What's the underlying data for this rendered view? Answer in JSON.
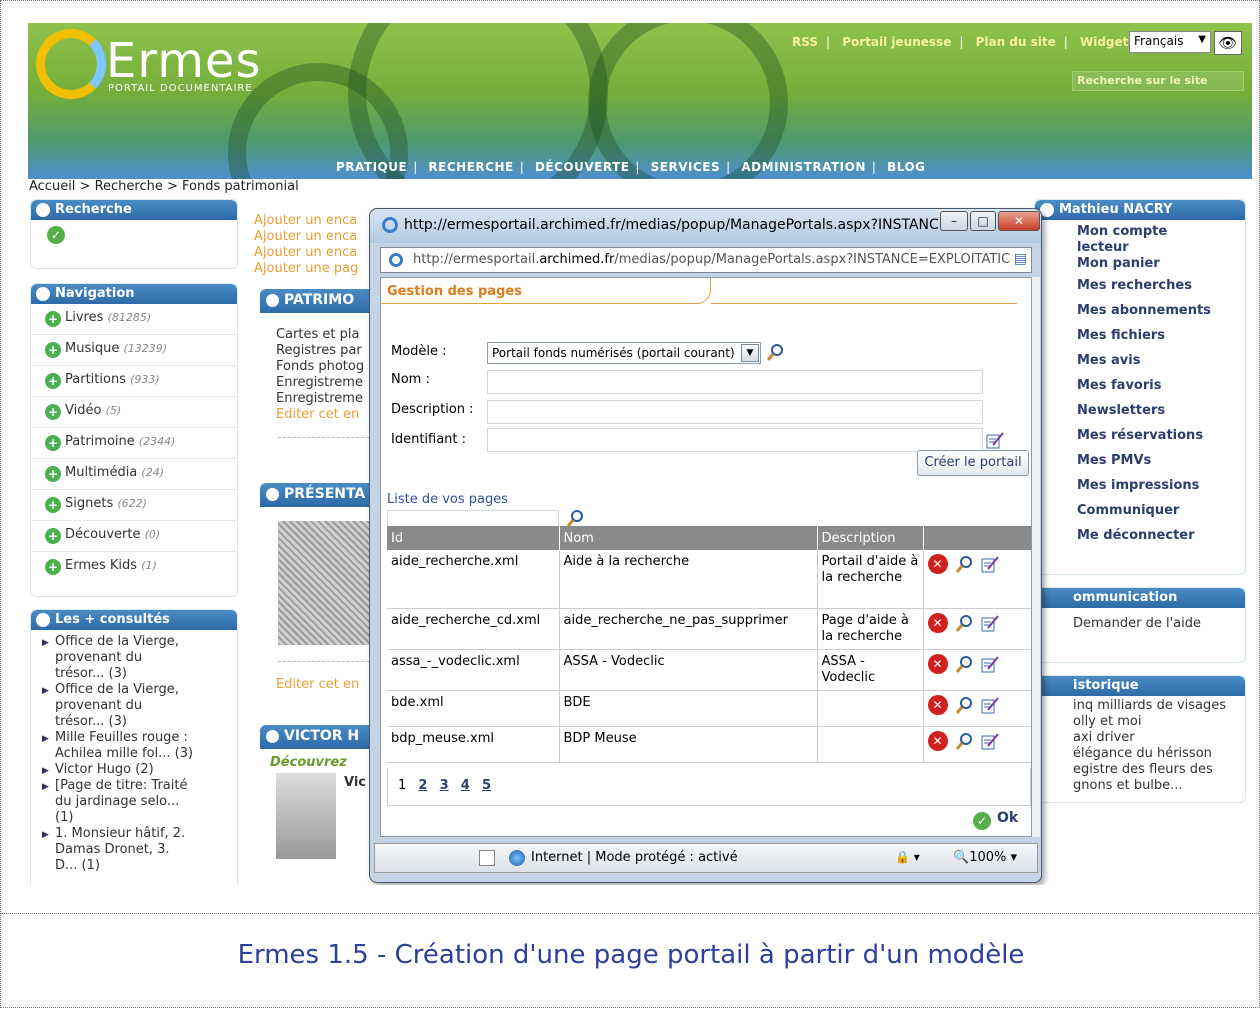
{
  "banner": {
    "logo_text": "Ermes",
    "logo_sub": "PORTAIL DOCUMENTAIRE",
    "top_links": [
      "RSS",
      "Portail jeunesse",
      "Plan du site",
      "Widgets"
    ],
    "language": "Français",
    "site_search_placeholder": "Recherche sur le site",
    "menu": [
      "PRATIQUE",
      "RECHERCHE",
      "DÉCOUVERTE",
      "SERVICES",
      "ADMINISTRATION",
      "BLOG"
    ]
  },
  "breadcrumb": "Accueil > Recherche > Fonds patrimonial",
  "left": {
    "recherche_title": "Recherche",
    "navigation_title": "Navigation",
    "nav_items": [
      {
        "label": "Livres",
        "count": "(81285)"
      },
      {
        "label": "Musique",
        "count": "(13239)"
      },
      {
        "label": "Partitions",
        "count": "(933)"
      },
      {
        "label": "Vidéo",
        "count": "(5)"
      },
      {
        "label": "Patrimoine",
        "count": "(2344)"
      },
      {
        "label": "Multimédia",
        "count": "(24)"
      },
      {
        "label": "Signets",
        "count": "(622)"
      },
      {
        "label": "Découverte",
        "count": "(0)"
      },
      {
        "label": "Ermes Kids",
        "count": "(1)"
      }
    ],
    "consultes_title": "Les + consultés",
    "consultes": [
      "Office de la Vierge, provenant du trésor... (3)",
      "Office de la Vierge, provenant du trésor... (3)",
      "Mille Feuilles rouge : Achilea mille fol... (3)",
      "Victor Hugo (2)",
      "[Page de titre: Traité du jardinage selo... (1)",
      "1. Monsieur hâtif, 2. Damas Dronet, 3. D... (1)"
    ]
  },
  "middle": {
    "add_links": [
      "Ajouter un enca",
      "Ajouter un enca",
      "Ajouter un enca",
      "Ajouter une pag"
    ],
    "patrimoine_title": "PATRIMO",
    "patrimoine_lines": [
      "Cartes et pla",
      "Registres par",
      "Fonds photog",
      "Enregistreme",
      "Enregistreme",
      "Editer cet en"
    ],
    "presentation_title": "PRÉSENTA",
    "edit_link": "Editer cet en",
    "victor_title": "VICTOR H",
    "decouvrez": "Découvrez",
    "vic": "Vic"
  },
  "right": {
    "user_title": "Mathieu NACRY",
    "user_links": [
      "Mon compte lecteur",
      "Mon panier",
      "Mes recherches",
      "Mes abonnements",
      "Mes fichiers",
      "Mes avis",
      "Mes favoris",
      "Newsletters",
      "Mes réservations",
      "Mes PMVs",
      "Mes impressions",
      "Communiquer",
      "Me déconnecter"
    ],
    "communication_title": "ommunication",
    "communication_link": "Demander de l'aide",
    "historique_title": "istorique",
    "historique": [
      "inq milliards de visages",
      "olly et moi",
      "axi driver",
      "élégance du hérisson",
      "egistre des fleurs des",
      "gnons et bulbe..."
    ]
  },
  "popup": {
    "title": "http://ermesportail.archimed.fr/medias/popup/ManagePortals.aspx?INSTANCE...",
    "address_prefix": "http://ermesportail.",
    "address_domain": "archimed.fr",
    "address_suffix": "/medias/popup/ManagePortals.aspx?INSTANCE=EXPLOITATIC",
    "section_title": "Gestion des pages",
    "labels": {
      "modele": "Modèle :",
      "nom": "Nom :",
      "description": "Description :",
      "identifiant": "Identifiant :"
    },
    "modele_value": "Portail fonds numérisés (portail courant)",
    "create_button": "Créer le portail",
    "list_label": "Liste de vos pages",
    "columns": [
      "Id",
      "Nom",
      "Description"
    ],
    "rows": [
      {
        "id": "aide_recherche.xml",
        "nom": "Aide à la recherche",
        "description": "Portail d'aide à la recherche"
      },
      {
        "id": "aide_recherche_cd.xml",
        "nom": "aide_recherche_ne_pas_supprimer",
        "description": "Page d'aide à la recherche"
      },
      {
        "id": "assa_-_vodeclic.xml",
        "nom": "ASSA - Vodeclic",
        "description": "ASSA - Vodeclic"
      },
      {
        "id": "bde.xml",
        "nom": "BDE",
        "description": ""
      },
      {
        "id": "bdp_meuse.xml",
        "nom": "BDP Meuse",
        "description": ""
      }
    ],
    "pager_current": "1",
    "pager_links": [
      "2",
      "3",
      "4",
      "5"
    ],
    "ok_label": "Ok",
    "status_text": "Internet | Mode protégé : activé",
    "zoom": "100%"
  },
  "caption": "Ermes 1.5 - Création d'une page portail à partir d'un modèle"
}
